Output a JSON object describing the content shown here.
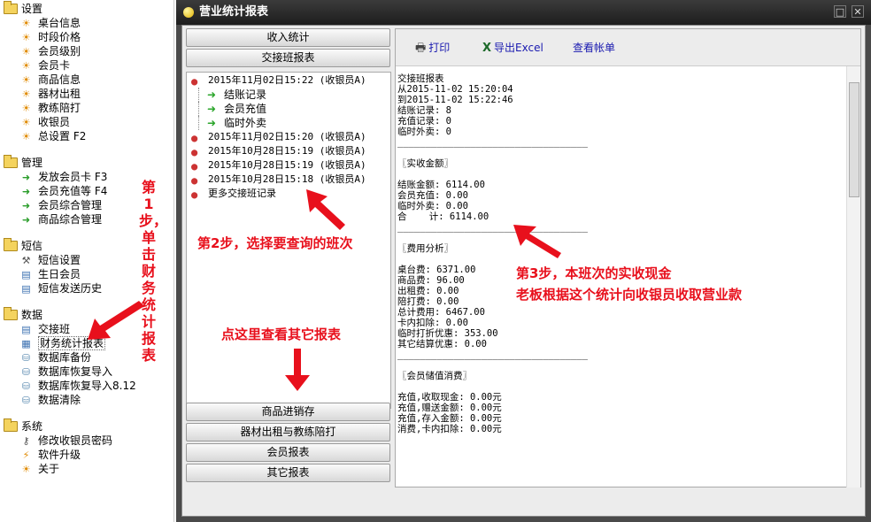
{
  "tree": {
    "groups": [
      {
        "label": "设置",
        "items": [
          {
            "label": "桌台信息",
            "icon": "gear-icon"
          },
          {
            "label": "时段价格",
            "icon": "gear-icon"
          },
          {
            "label": "会员级别",
            "icon": "gear-icon"
          },
          {
            "label": "会员卡",
            "icon": "gear-icon"
          },
          {
            "label": "商品信息",
            "icon": "gear-icon"
          },
          {
            "label": "器材出租",
            "icon": "gear-icon"
          },
          {
            "label": "教练陪打",
            "icon": "gear-icon"
          },
          {
            "label": "收银员",
            "icon": "gear-icon"
          },
          {
            "label": "总设置 F2",
            "icon": "gear-icon"
          }
        ]
      },
      {
        "label": "管理",
        "items": [
          {
            "label": "发放会员卡 F3",
            "icon": "arrow-icon"
          },
          {
            "label": "会员充值等 F4",
            "icon": "arrow-icon"
          },
          {
            "label": "会员综合管理",
            "icon": "arrow-icon"
          },
          {
            "label": "商品综合管理",
            "icon": "arrow-icon"
          }
        ]
      },
      {
        "label": "短信",
        "items": [
          {
            "label": "短信设置",
            "icon": "tools-icon"
          },
          {
            "label": "生日会员",
            "icon": "document-icon"
          },
          {
            "label": "短信发送历史",
            "icon": "document-icon"
          }
        ]
      },
      {
        "label": "数据",
        "items": [
          {
            "label": "交接班",
            "icon": "document-icon"
          },
          {
            "label": "财务统计报表",
            "icon": "table-icon"
          },
          {
            "label": "数据库备份",
            "icon": "database-icon"
          },
          {
            "label": "数据库恢复导入",
            "icon": "database-icon"
          },
          {
            "label": "数据库恢复导入8.12",
            "icon": "database-icon"
          },
          {
            "label": "数据清除",
            "icon": "database-icon"
          }
        ]
      },
      {
        "label": "系统",
        "items": [
          {
            "label": "修改收银员密码",
            "icon": "key-icon"
          },
          {
            "label": "软件升级",
            "icon": "lightning-icon"
          },
          {
            "label": "关于",
            "icon": "gear-icon"
          }
        ]
      }
    ]
  },
  "window": {
    "title": "营业统计报表",
    "close": "✕",
    "max": "□"
  },
  "left": {
    "top_buttons": [
      "收入统计",
      "交接班报表"
    ],
    "shifts": [
      {
        "label": "2015年11月02日15:22 (收银员A)"
      },
      {
        "label": "结账记录",
        "sub": true
      },
      {
        "label": "会员充值",
        "sub": true
      },
      {
        "label": "临时外卖",
        "sub": true
      },
      {
        "label": "2015年11月02日15:20 (收银员A)"
      },
      {
        "label": "2015年10月28日15:19 (收银员A)"
      },
      {
        "label": "2015年10月28日15:19 (收银员A)"
      },
      {
        "label": "2015年10月28日15:18 (收银员A)"
      },
      {
        "label": "更多交接班记录"
      }
    ],
    "bottom_buttons": [
      "商品进销存",
      "器材出租与教练陪打",
      "会员报表",
      "其它报表"
    ]
  },
  "toolbar": {
    "print": "打印",
    "excel": "导出Excel",
    "view": "查看帐单"
  },
  "report": "交接班报表\n从2015-11-02 15:20:04\n到2015-11-02 15:22:46\n结账记录: 8\n充值记录: 0\n临时外卖: 0\n__________________________________\n\n〖实收金额〗\n\n结账金额: 6114.00\n会员充值: 0.00\n临时外卖: 0.00\n合    计: 6114.00\n__________________________________\n\n〖费用分析〗\n\n桌台费: 6371.00\n商品费: 96.00\n出租费: 0.00\n陪打费: 0.00\n总计费用: 6467.00\n卡内扣除: 0.00\n临时打折优惠: 353.00\n其它结算优惠: 0.00\n__________________________________\n\n〖会员储值消费〗\n\n充值,收取现金: 0.00元\n充值,赠送金额: 0.00元\n充值,存入金额: 0.00元\n消费,卡内扣除: 0.00元",
  "annotations": {
    "step1": "第\n1\n步，\n单\n击\n财\n务\n统\n计\n报\n表",
    "step2": "第2步，选择要查询的班次",
    "step3a": "第3步，本班次的实收现金",
    "step3b": "老板根据这个统计向收银员收取营业款",
    "other": "点这里查看其它报表"
  }
}
